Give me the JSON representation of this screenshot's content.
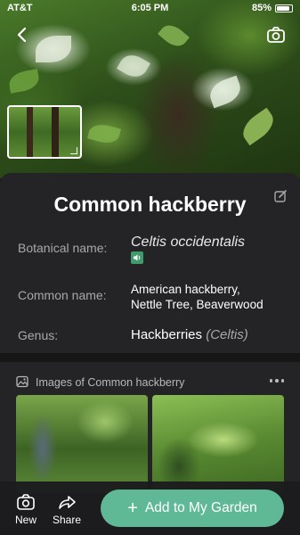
{
  "status_bar": {
    "carrier": "AT&T",
    "time": "6:05 PM",
    "battery": "85%",
    "battery_level": 0.85
  },
  "plant": {
    "name": "Common hackberry",
    "rows": [
      {
        "label": "Botanical name:",
        "value": "Celtis occidentalis"
      },
      {
        "label": "Common name:",
        "value_line1": "American hackberry,",
        "value_line2": "Nettle Tree, Beaverwood"
      },
      {
        "label": "Genus:",
        "value": "Hackberries",
        "value_note": "(Celtis)"
      }
    ]
  },
  "images": {
    "title": "Images of Common hackberry"
  },
  "toolbar": {
    "new_label": "New",
    "share_label": "Share",
    "add_label": "Add to My Garden",
    "add_symbol": "+"
  },
  "colors": {
    "accent": "#5fb896",
    "card": "#242426",
    "background": "#1c1c1e",
    "speaker": "#3f9b6b"
  },
  "icons": [
    "back-chevron-icon",
    "camera-icon",
    "edit-icon",
    "speaker-icon",
    "image-icon",
    "more-icon",
    "share-icon",
    "expand-icon"
  ]
}
